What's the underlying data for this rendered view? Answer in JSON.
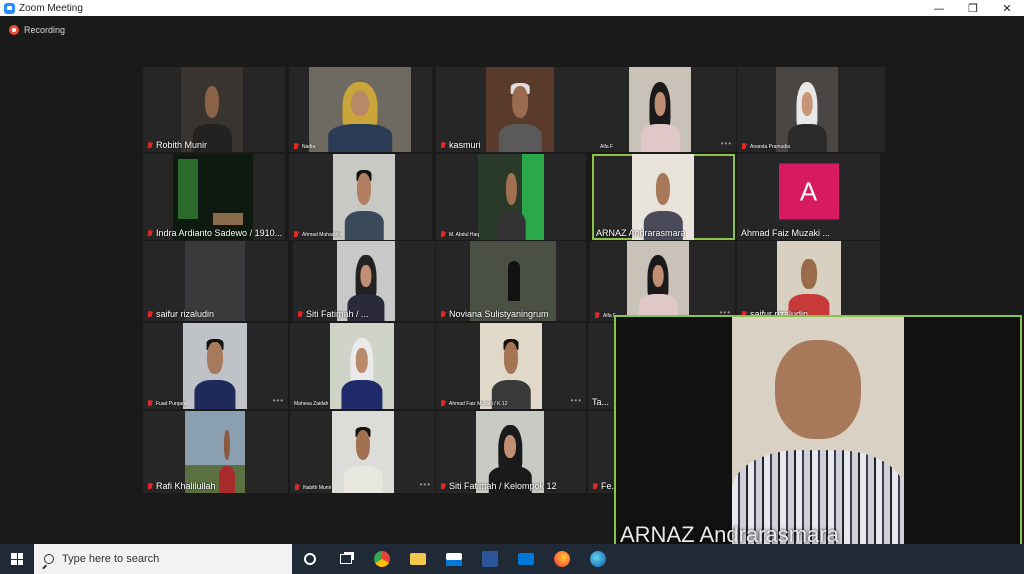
{
  "window": {
    "title": "Zoom Meeting",
    "minimize": "—",
    "restore": "❐",
    "close": "✕"
  },
  "meeting": {
    "recording_label": "Recording"
  },
  "tiles": [
    {
      "name": "Robith Munir"
    },
    {
      "name": "Nadia"
    },
    {
      "name": "kasmuri"
    },
    {
      "name": "Alfa F"
    },
    {
      "name": "Ananda Pramudia"
    },
    {
      "name": "Indra Ardianto Sadewo / 1910..."
    },
    {
      "name": "Ahmad Muhaddits"
    },
    {
      "name": "M. Abdul Haq"
    },
    {
      "name": "ARNAZ Andrarasmara"
    },
    {
      "name": "Ahmad Faiz Muzaki ...",
      "avatar_letter": "A"
    },
    {
      "name": "saifur rizaludin"
    },
    {
      "name": "Siti Fatimah / ..."
    },
    {
      "name": "Noviana Sulistyaningrum"
    },
    {
      "name": "Alfa F"
    },
    {
      "name": "saifur rizaludin"
    },
    {
      "name": "Fuad Purqani"
    },
    {
      "name": "Mahesa Zaidah"
    },
    {
      "name": "Ahmad Faiz Muzaki / K 12"
    },
    {
      "name": "Ta..."
    },
    {
      "name": "Rafi Khalilullah"
    },
    {
      "name": "Nabith Munir"
    },
    {
      "name": "Siti Fatimah / Kelompok 12"
    },
    {
      "name": "Fe..."
    }
  ],
  "spotlight": {
    "name": "ARNAZ Andrarasmara"
  },
  "taskbar": {
    "search_placeholder": "Type here to search",
    "icons": [
      "windows-start-icon",
      "cortana-icon",
      "task-view-icon",
      "chrome-icon",
      "file-explorer-icon",
      "store-icon",
      "word-icon",
      "mail-icon",
      "firefox-icon",
      "edge-icon"
    ]
  },
  "colors": {
    "active_border": "#8bc34a",
    "muted_mic": "#e02828",
    "avatar_bg": "#d81b60",
    "zoom_blue": "#2D8CFF"
  }
}
